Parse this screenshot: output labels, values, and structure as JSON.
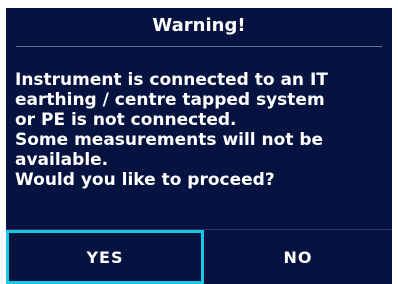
{
  "dialog": {
    "title": "Warning!",
    "message_lines": [
      "Instrument is connected to an IT",
      "earthing / centre tapped system",
      "or PE is not connected.",
      "Some measurements will not be",
      "available.",
      "Would you like to proceed?"
    ],
    "buttons": {
      "yes_label": "YES",
      "no_label": "NO",
      "selected": "YES"
    }
  },
  "colors": {
    "dialog_background": "#061240",
    "text": "#ffffff",
    "selection_border": "#19c8e6",
    "page_background": "#ffffff"
  }
}
